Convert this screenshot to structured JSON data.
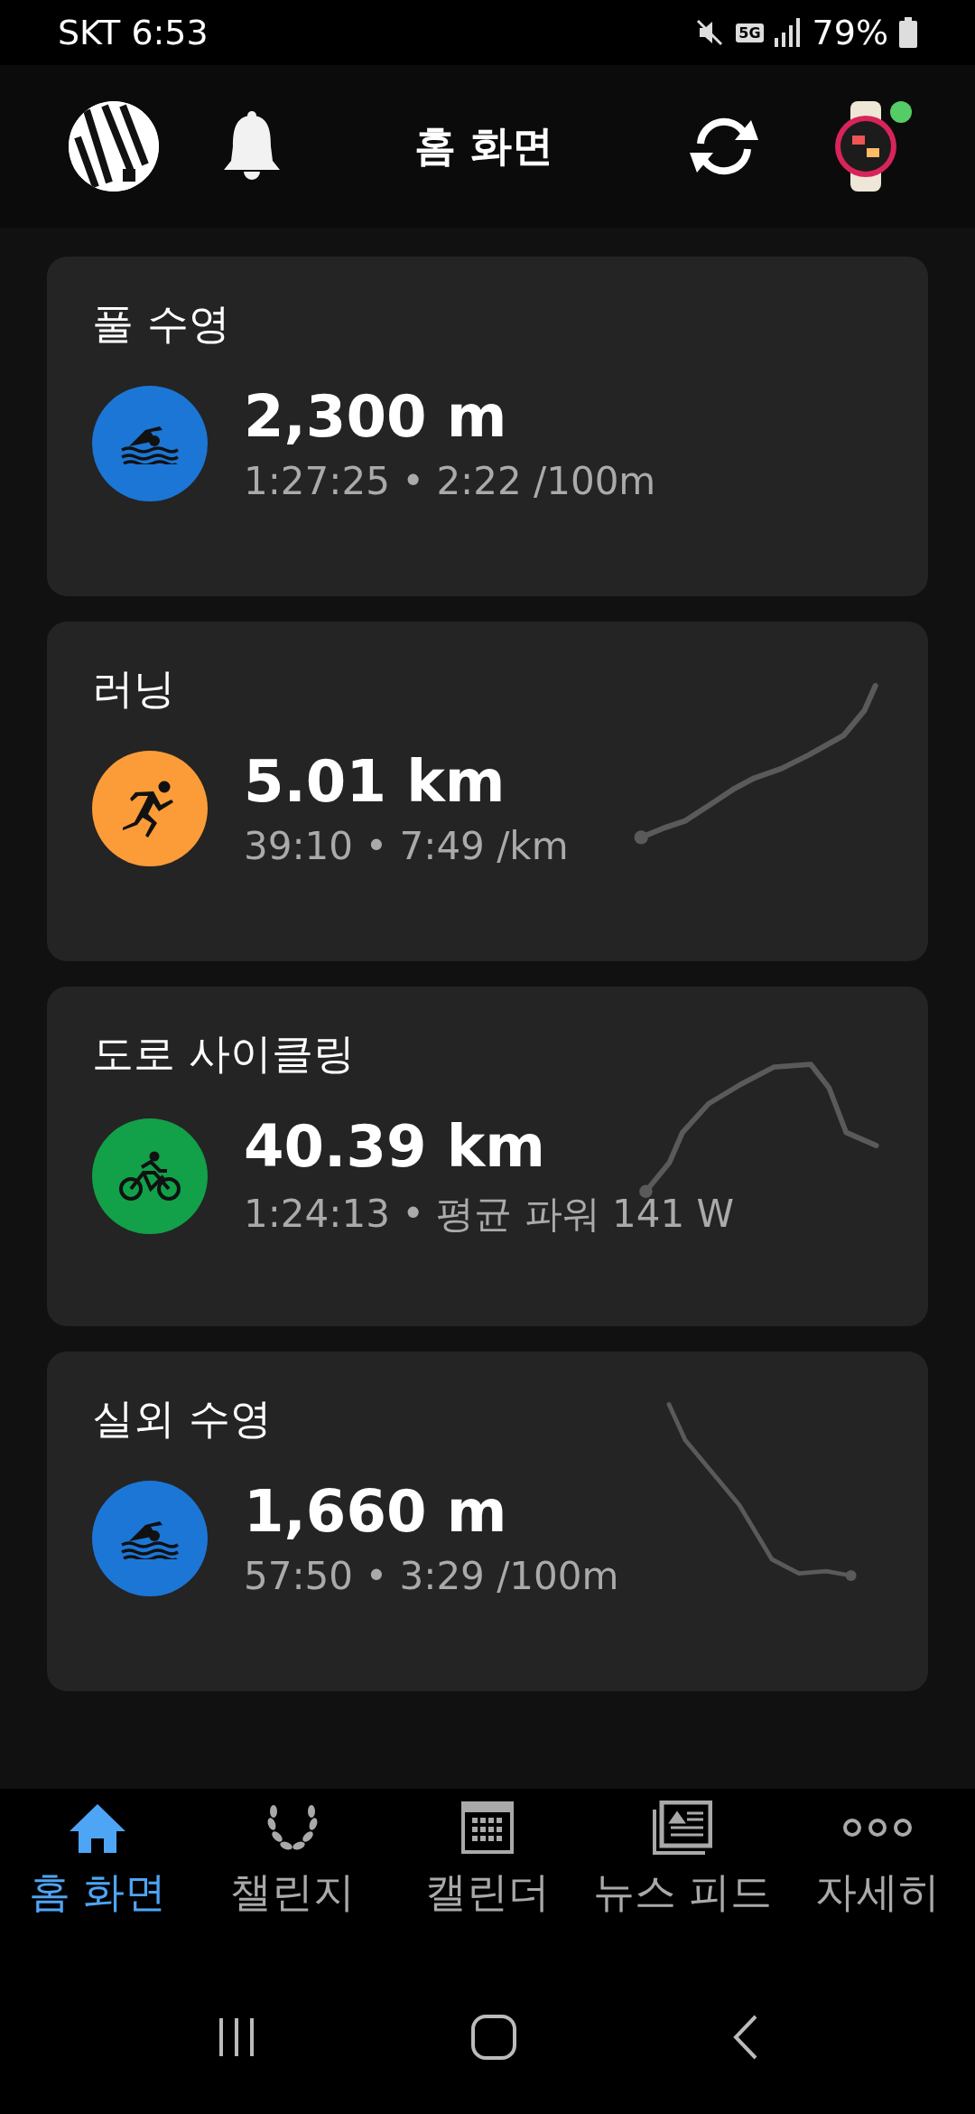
{
  "status_bar": {
    "carrier_time": "SKT 6:53",
    "network": "5G",
    "battery": "79%"
  },
  "header": {
    "title": "홈 화면",
    "device_connected": true
  },
  "activities": [
    {
      "title": "풀 수영",
      "kind": "swim",
      "color": "#1c76d6",
      "distance": "2,300 m",
      "details": "1:27:25 • 2:22 /100m"
    },
    {
      "title": "러닝",
      "kind": "run",
      "color": "#fb9c38",
      "distance": "5.01 km",
      "details": "39:10 • 7:49 /km"
    },
    {
      "title": "도로 사이클링",
      "kind": "bike",
      "color": "#12a049",
      "distance": "40.39 km",
      "details": "1:24:13 • 평균 파워 141 W"
    },
    {
      "title": "실외 수영",
      "kind": "swim",
      "color": "#1c76d6",
      "distance": "1,660 m",
      "details": "57:50 • 3:29 /100m"
    }
  ],
  "bottom_nav": [
    {
      "label": "홈 화면",
      "kind": "home",
      "selected": true
    },
    {
      "label": "챌린지",
      "kind": "challenge",
      "selected": false
    },
    {
      "label": "캘린더",
      "kind": "calendar",
      "selected": false
    },
    {
      "label": "뉴스 피드",
      "kind": "news",
      "selected": false
    },
    {
      "label": "자세히",
      "kind": "more",
      "selected": false
    }
  ]
}
